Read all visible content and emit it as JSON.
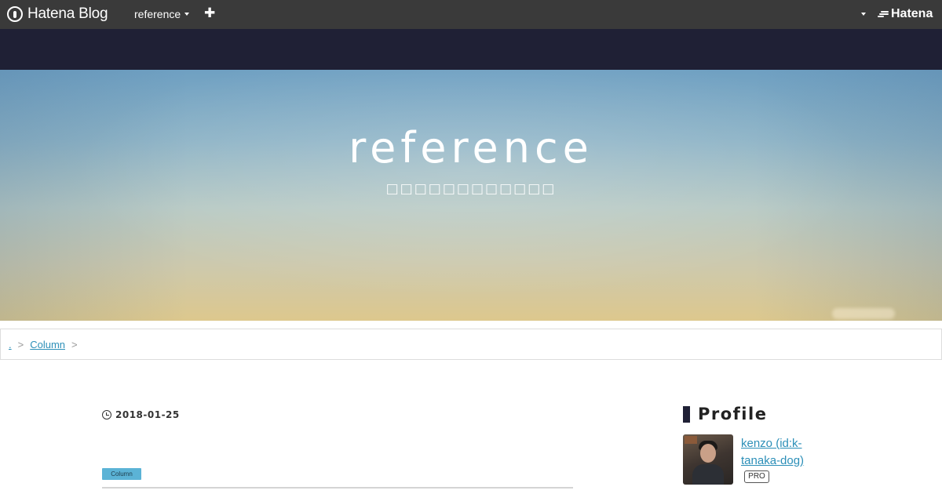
{
  "globalbar": {
    "logo_text": "Hatena Blog",
    "blog_selector": "reference",
    "add_label": "✚",
    "right_brand": "Hatena"
  },
  "hero": {
    "title": "reference",
    "subtitle": "□□□□□□□□□□□□"
  },
  "breadcrumb": {
    "items": [
      {
        "label": "."
      },
      {
        "label": "Column"
      }
    ],
    "separator": ">"
  },
  "article": {
    "date": "2018-01-25",
    "category": "Column"
  },
  "sidebar": {
    "profile_heading": "Profile",
    "profile_name": "kenzo (id:k-tanaka-dog)",
    "badge": "PRO"
  },
  "colors": {
    "globalbar_bg": "#3a3a3a",
    "header_band": "#1f2035",
    "link": "#2c8fb8",
    "category_tag": "#5bb3d6"
  }
}
